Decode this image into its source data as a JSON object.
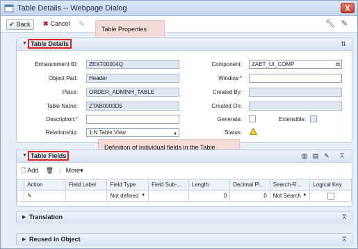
{
  "window": {
    "title": "Table Details -- Webpage Dialog",
    "close": "X"
  },
  "toolbar": {
    "back": "Back",
    "cancel": "Cancel"
  },
  "callouts": {
    "table_properties": "Table Properties",
    "field_definition": "Definition of individual fields in the Table"
  },
  "details": {
    "title": "Table Details",
    "enhancement_id": {
      "label": "Enhancement ID:",
      "value": "ZEXT00004Q"
    },
    "object_part": {
      "label": "Object Part:",
      "value": "Header"
    },
    "place": {
      "label": "Place:",
      "value": "ORDER_ADMINH_TABLE"
    },
    "table_name": {
      "label": "Table Name:",
      "value": "ZTAB0000D5"
    },
    "description": {
      "label": "Description:",
      "value": ""
    },
    "relationship": {
      "label": "Relationship:",
      "value": "1:N Table View"
    },
    "component": {
      "label": "Component:",
      "value": "ZAET_UI_COMP"
    },
    "window_field": {
      "label": "Window:",
      "value": ""
    },
    "created_by": {
      "label": "Created By:",
      "value": ""
    },
    "created_on": {
      "label": "Created On:",
      "value": ""
    },
    "generate": {
      "label": "Generate:"
    },
    "extensible": {
      "label": "Extensible:"
    },
    "status": {
      "label": "Status:"
    },
    "required_mark": "*"
  },
  "fields": {
    "title": "Table Fields",
    "add": "Add",
    "more": "More",
    "columns": [
      "Action",
      "Field Label",
      "Field Type",
      "Field Sub-...",
      "Length",
      "Decimal Pl...",
      "Search-R...",
      "Logical Key"
    ],
    "row": {
      "field_label": "",
      "field_type": "Not defined",
      "field_sub": "",
      "length": "0",
      "decimal": "0",
      "search": "Not Search"
    }
  },
  "translation": {
    "title": "Translation"
  },
  "reused": {
    "title": "Reused in Object"
  },
  "colors": {
    "accent": "#e0231f",
    "callout": "#f3dcd8",
    "header": "#d9e4f1"
  }
}
